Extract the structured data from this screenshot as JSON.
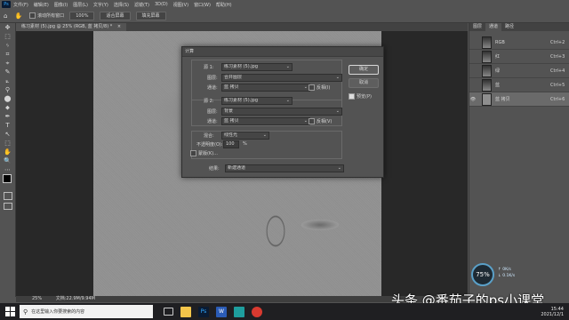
{
  "menu": {
    "logo": "Ps",
    "items": [
      "文件(F)",
      "编辑(E)",
      "图像(I)",
      "图层(L)",
      "文字(Y)",
      "选择(S)",
      "滤镜(T)",
      "3D(D)",
      "视图(V)",
      "窗口(W)",
      "帮助(H)"
    ]
  },
  "options": {
    "scroll_all": "滚动所有窗口",
    "zoom_100": "100%",
    "fit_screen": "适合屏幕",
    "fill_screen": "填充屏幕"
  },
  "document_tab": "练习素材 (5).jpg @ 25% (RGB, 蓝 拷贝/8) *",
  "tools": [
    "✥",
    "⬚",
    "ᛃ",
    "⌗",
    "⌖",
    "✎",
    "⟀",
    "⚲",
    "⬤",
    "⬥",
    "✒",
    "T",
    "↖",
    "⬚",
    "✋",
    "🔍",
    "⋯"
  ],
  "dialog": {
    "title": "计算",
    "source1": {
      "label": "源 1:",
      "file": "练习素材 (5).jpg",
      "layer_label": "图层:",
      "layer": "合并图层",
      "channel_label": "通道:",
      "channel": "蓝 拷贝",
      "invert": "反相(I)"
    },
    "source2": {
      "label": "源 2:",
      "file": "练习素材 (5).jpg",
      "layer_label": "图层:",
      "layer": "背景",
      "channel_label": "通道:",
      "channel": "蓝 拷贝",
      "invert": "反相(V)"
    },
    "blend": {
      "label": "混合:",
      "mode": "线性光",
      "opacity_label": "不透明度(O):",
      "opacity": "100",
      "unit": "%",
      "mask": "蒙版(K)..."
    },
    "result": {
      "label": "结果:",
      "value": "新建通道"
    },
    "ok": "确定",
    "cancel": "取消",
    "preview": "预览(P)"
  },
  "panels": {
    "tabs": [
      "图层",
      "通道",
      "路径"
    ],
    "channels": [
      {
        "name": "RGB",
        "shortcut": "Ctrl+2"
      },
      {
        "name": "红",
        "shortcut": "Ctrl+3"
      },
      {
        "name": "绿",
        "shortcut": "Ctrl+4"
      },
      {
        "name": "蓝",
        "shortcut": "Ctrl+5"
      },
      {
        "name": "蓝 拷贝",
        "shortcut": "Ctrl+6"
      }
    ]
  },
  "status": {
    "zoom": "25%",
    "doc": "文档:22.9M/9.94M"
  },
  "taskbar": {
    "search_placeholder": "在这里输入你要搜索的内容",
    "date": "2021/12/1",
    "time": "15:44"
  },
  "perf": {
    "percent": "75%",
    "up": "0K/s",
    "down": "0.1K/s"
  },
  "watermark": "头条 @番茄子的ps小课堂"
}
